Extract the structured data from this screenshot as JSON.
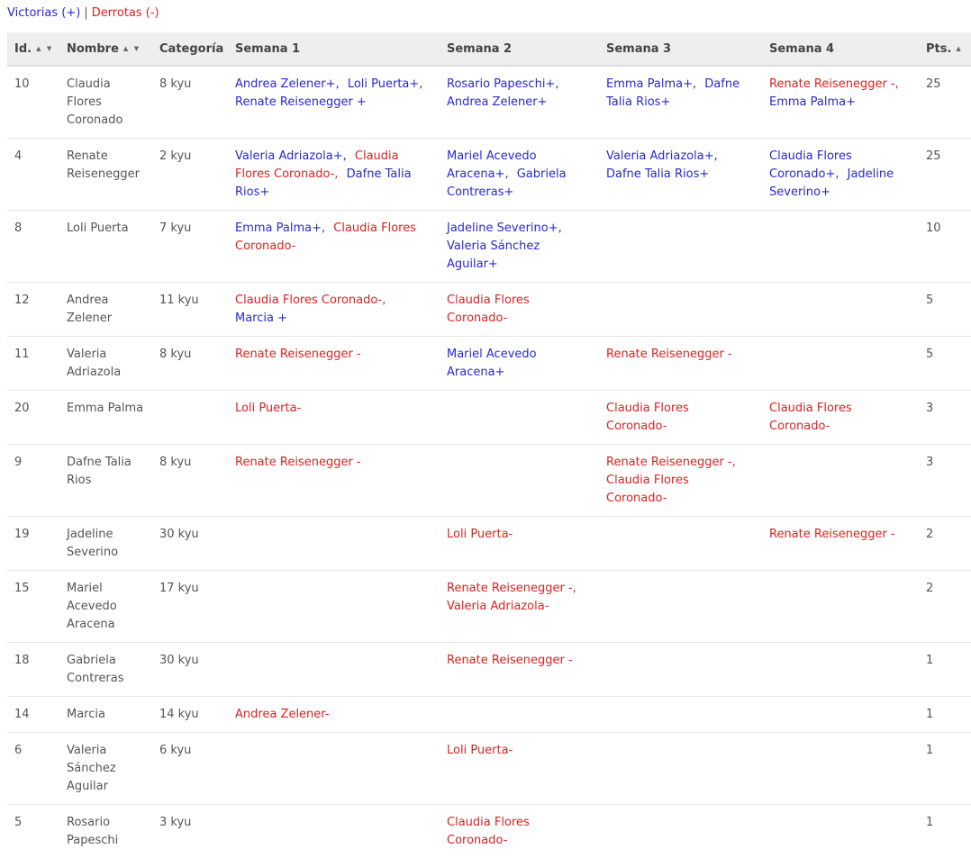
{
  "legend": {
    "wins": "Victorias (+)",
    "separator": "|",
    "losses": "Derrotas (-)"
  },
  "columns": [
    {
      "key": "id",
      "label": "Id.",
      "sort": "▲ ▼"
    },
    {
      "key": "nombre",
      "label": "Nombre",
      "sort": "▲ ▼"
    },
    {
      "key": "categoria",
      "label": "Categoría",
      "sort": ""
    },
    {
      "key": "s1",
      "label": "Semana 1",
      "sort": ""
    },
    {
      "key": "s2",
      "label": "Semana 2",
      "sort": ""
    },
    {
      "key": "s3",
      "label": "Semana 3",
      "sort": ""
    },
    {
      "key": "s4",
      "label": "Semana 4",
      "sort": ""
    },
    {
      "key": "pts",
      "label": "Pts.",
      "sort": "▲"
    }
  ],
  "rows": [
    {
      "id": "10",
      "nombre": "Claudia Flores Coronado",
      "categoria": "8 kyu",
      "s1": [
        {
          "text": "Andrea Zelener+,",
          "result": "win"
        },
        {
          "text": "Loli Puerta+,",
          "result": "win"
        },
        {
          "text": "Renate Reisenegger +",
          "result": "win"
        }
      ],
      "s2": [
        {
          "text": "Rosario Papeschi+,",
          "result": "win"
        },
        {
          "text": "Andrea Zelener+",
          "result": "win"
        }
      ],
      "s3": [
        {
          "text": "Emma Palma+,",
          "result": "win"
        },
        {
          "text": "Dafne Talia Rios+",
          "result": "win"
        }
      ],
      "s4": [
        {
          "text": "Renate Reisenegger -,",
          "result": "loss"
        },
        {
          "text": "Emma Palma+",
          "result": "win"
        }
      ],
      "pts": "25"
    },
    {
      "id": "4",
      "nombre": "Renate Reisenegger",
      "categoria": "2 kyu",
      "s1": [
        {
          "text": "Valeria Adriazola+,",
          "result": "win"
        },
        {
          "text": "Claudia Flores Coronado-,",
          "result": "loss"
        },
        {
          "text": "Dafne Talia Rios+",
          "result": "win"
        }
      ],
      "s2": [
        {
          "text": "Mariel Acevedo Aracena+,",
          "result": "win"
        },
        {
          "text": "Gabriela Contreras+",
          "result": "win"
        }
      ],
      "s3": [
        {
          "text": "Valeria Adriazola+,",
          "result": "win"
        },
        {
          "text": "Dafne Talia Rios+",
          "result": "win"
        }
      ],
      "s4": [
        {
          "text": "Claudia Flores Coronado+,",
          "result": "win"
        },
        {
          "text": "Jadeline Severino+",
          "result": "win"
        }
      ],
      "pts": "25"
    },
    {
      "id": "8",
      "nombre": "Loli Puerta",
      "categoria": "7 kyu",
      "s1": [
        {
          "text": "Emma Palma+,",
          "result": "win"
        },
        {
          "text": "Claudia Flores Coronado-",
          "result": "loss"
        }
      ],
      "s2": [
        {
          "text": "Jadeline Severino+,",
          "result": "win"
        },
        {
          "text": "Valeria Sánchez Aguilar+",
          "result": "win"
        }
      ],
      "s3": [],
      "s4": [],
      "pts": "10"
    },
    {
      "id": "12",
      "nombre": "Andrea Zelener",
      "categoria": "11 kyu",
      "s1": [
        {
          "text": "Claudia Flores Coronado-,",
          "result": "loss"
        },
        {
          "text": "Marcia +",
          "result": "win"
        }
      ],
      "s2": [
        {
          "text": "Claudia Flores Coronado-",
          "result": "loss"
        }
      ],
      "s3": [],
      "s4": [],
      "pts": "5"
    },
    {
      "id": "11",
      "nombre": "Valeria Adriazola",
      "categoria": "8 kyu",
      "s1": [
        {
          "text": "Renate Reisenegger -",
          "result": "loss"
        }
      ],
      "s2": [
        {
          "text": "Mariel Acevedo Aracena+",
          "result": "win"
        }
      ],
      "s3": [
        {
          "text": "Renate Reisenegger -",
          "result": "loss"
        }
      ],
      "s4": [],
      "pts": "5"
    },
    {
      "id": "20",
      "nombre": "Emma Palma",
      "categoria": "",
      "s1": [
        {
          "text": "Loli Puerta-",
          "result": "loss"
        }
      ],
      "s2": [],
      "s3": [
        {
          "text": "Claudia Flores Coronado-",
          "result": "loss"
        }
      ],
      "s4": [
        {
          "text": "Claudia Flores Coronado-",
          "result": "loss"
        }
      ],
      "pts": "3"
    },
    {
      "id": "9",
      "nombre": "Dafne Talia Rios",
      "categoria": "8 kyu",
      "s1": [
        {
          "text": "Renate Reisenegger -",
          "result": "loss"
        }
      ],
      "s2": [],
      "s3": [
        {
          "text": "Renate Reisenegger -,",
          "result": "loss"
        },
        {
          "text": "Claudia Flores Coronado-",
          "result": "loss"
        }
      ],
      "s4": [],
      "pts": "3"
    },
    {
      "id": "19",
      "nombre": "Jadeline Severino",
      "categoria": "30 kyu",
      "s1": [],
      "s2": [
        {
          "text": "Loli Puerta-",
          "result": "loss"
        }
      ],
      "s3": [],
      "s4": [
        {
          "text": "Renate Reisenegger -",
          "result": "loss"
        }
      ],
      "pts": "2"
    },
    {
      "id": "15",
      "nombre": "Mariel Acevedo Aracena",
      "categoria": "17 kyu",
      "s1": [],
      "s2": [
        {
          "text": "Renate Reisenegger -,",
          "result": "loss"
        },
        {
          "text": "Valeria Adriazola-",
          "result": "loss"
        }
      ],
      "s3": [],
      "s4": [],
      "pts": "2"
    },
    {
      "id": "18",
      "nombre": "Gabriela Contreras",
      "categoria": "30 kyu",
      "s1": [],
      "s2": [
        {
          "text": "Renate Reisenegger -",
          "result": "loss"
        }
      ],
      "s3": [],
      "s4": [],
      "pts": "1"
    },
    {
      "id": "14",
      "nombre": "Marcia",
      "categoria": "14 kyu",
      "s1": [
        {
          "text": "Andrea Zelener-",
          "result": "loss"
        }
      ],
      "s2": [],
      "s3": [],
      "s4": [],
      "pts": "1"
    },
    {
      "id": "6",
      "nombre": "Valeria Sánchez Aguilar",
      "categoria": "6 kyu",
      "s1": [],
      "s2": [
        {
          "text": "Loli Puerta-",
          "result": "loss"
        }
      ],
      "s3": [],
      "s4": [],
      "pts": "1"
    },
    {
      "id": "5",
      "nombre": "Rosario Papeschi",
      "categoria": "3 kyu",
      "s1": [],
      "s2": [
        {
          "text": "Claudia Flores Coronado-",
          "result": "loss"
        }
      ],
      "s3": [],
      "s4": [],
      "pts": "1"
    }
  ],
  "colors": {
    "win": "#2828d8",
    "loss": "#e02020",
    "text": "#555555",
    "header_bg": "#eeeeee"
  }
}
